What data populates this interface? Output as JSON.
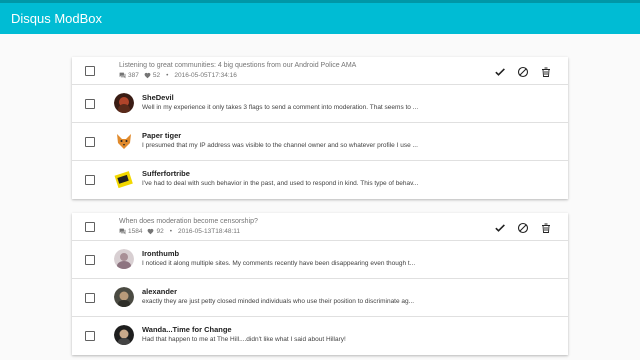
{
  "app": {
    "title": "Disqus ModBox"
  },
  "threads": [
    {
      "title": "Listening to great communities: 4 big questions from our Android Police AMA",
      "comments_count": "387",
      "likes_count": "52",
      "timestamp": "2016-05-05T17:34:16",
      "comments": [
        {
          "author": "SheDevil",
          "text": "Well in my experience it only takes 3 flags to send a comment into moderation. That seems to ..."
        },
        {
          "author": "Paper tiger",
          "text": "I presumed that my IP address was visible to the channel owner and so whatever profile I use ..."
        },
        {
          "author": "Sufferfortribe",
          "text": "I've had to deal with such behavior in the past, and used to respond in kind. This type of behav..."
        }
      ]
    },
    {
      "title": "When does moderation become censorship?",
      "comments_count": "1584",
      "likes_count": "92",
      "timestamp": "2016-05-13T18:48:11",
      "comments": [
        {
          "author": "Ironthumb",
          "text": "I noticed it along multiple sites. My comments recently have been disappearing even though t..."
        },
        {
          "author": "alexander",
          "text": "exactly they are just petty closed minded individuals who use their position to discriminate ag..."
        },
        {
          "author": "Wanda...Time for Change",
          "text": "Had that happen to me at The Hill....didn't like what I said about Hillary!"
        }
      ]
    }
  ],
  "icons": {
    "approve": "check-icon",
    "spam": "block-icon",
    "delete": "trash-icon",
    "comments": "comment-bubble-icon",
    "likes": "heart-icon"
  },
  "colors": {
    "appbar": "#00bcd4",
    "appbar_border": "#0097a7"
  }
}
